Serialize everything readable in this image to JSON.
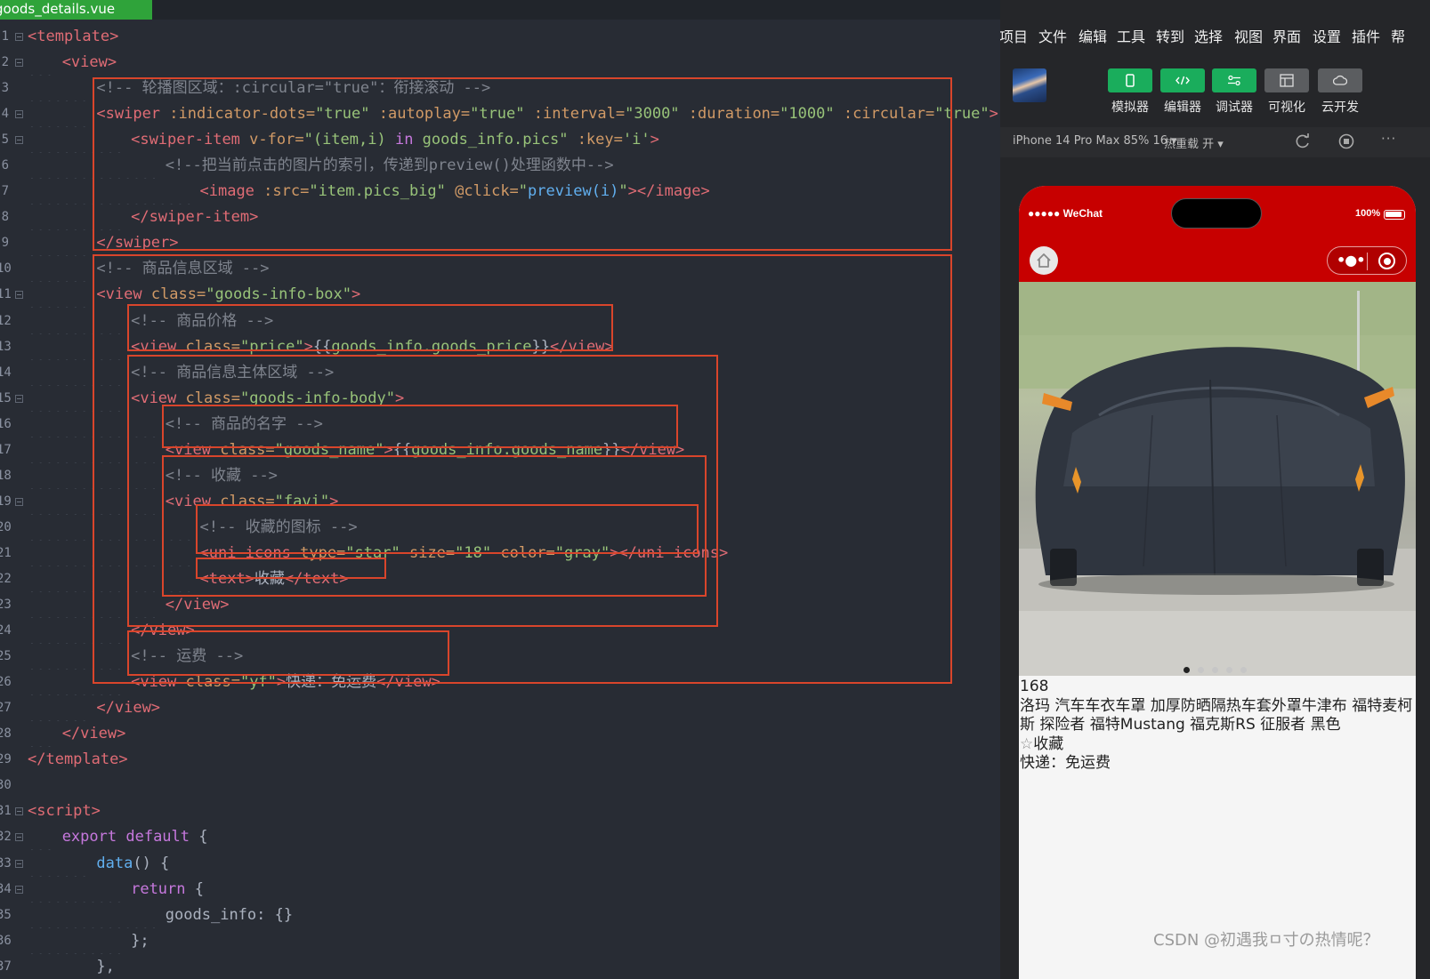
{
  "editor": {
    "tab_title": "goods_details.vue",
    "lines": [
      {
        "num": "1",
        "fold": true,
        "indent": 0,
        "tokens": [
          [
            "tag",
            "<template>"
          ]
        ]
      },
      {
        "num": "2",
        "fold": true,
        "indent": 1,
        "tokens": [
          [
            "tag",
            "<view>"
          ]
        ]
      },
      {
        "num": "3",
        "fold": false,
        "indent": 2,
        "tokens": [
          [
            "cmt",
            "<!-- 轮播图区域：:circular=\"true\"：衔接滚动 -->"
          ]
        ]
      },
      {
        "num": "4",
        "fold": true,
        "indent": 2,
        "tokens": [
          [
            "tag",
            "<swiper"
          ],
          [
            "txt",
            " "
          ],
          [
            "attr",
            ":indicator-dots="
          ],
          [
            "str",
            "\"true\""
          ],
          [
            "txt",
            " "
          ],
          [
            "attr",
            ":autoplay="
          ],
          [
            "str",
            "\"true\""
          ],
          [
            "txt",
            " "
          ],
          [
            "attr",
            ":interval="
          ],
          [
            "str",
            "\"3000\""
          ],
          [
            "txt",
            " "
          ],
          [
            "attr",
            ":duration="
          ],
          [
            "str",
            "\"1000\""
          ],
          [
            "txt",
            " "
          ],
          [
            "attr",
            ":circular="
          ],
          [
            "str",
            "\"true\""
          ],
          [
            "tag",
            ">"
          ]
        ]
      },
      {
        "num": "5",
        "fold": true,
        "indent": 3,
        "tokens": [
          [
            "tag",
            "<swiper-item"
          ],
          [
            "txt",
            " "
          ],
          [
            "attr",
            "v-for="
          ],
          [
            "str",
            "\"(item,i) "
          ],
          [
            "kw",
            "in"
          ],
          [
            "str",
            " goods_info.pics\""
          ],
          [
            "txt",
            " "
          ],
          [
            "attr",
            ":key="
          ],
          [
            "str",
            "'i'"
          ],
          [
            "tag",
            ">"
          ]
        ]
      },
      {
        "num": "6",
        "fold": false,
        "indent": 4,
        "tokens": [
          [
            "cmt",
            "<!--把当前点击的图片的索引，传递到preview()处理函数中-->"
          ]
        ]
      },
      {
        "num": "7",
        "fold": false,
        "indent": 5,
        "tokens": [
          [
            "tag",
            "<image"
          ],
          [
            "txt",
            " "
          ],
          [
            "attr",
            ":src="
          ],
          [
            "str",
            "\"item.pics_big\""
          ],
          [
            "txt",
            " "
          ],
          [
            "attr",
            "@click="
          ],
          [
            "str",
            "\""
          ],
          [
            "fn",
            "preview(i)"
          ],
          [
            "str",
            "\""
          ],
          [
            "tag",
            "></image>"
          ]
        ]
      },
      {
        "num": "8",
        "fold": false,
        "indent": 3,
        "tokens": [
          [
            "tag",
            "</swiper-item>"
          ]
        ]
      },
      {
        "num": "9",
        "fold": false,
        "indent": 2,
        "tokens": [
          [
            "tag",
            "</swiper>"
          ]
        ]
      },
      {
        "num": "10",
        "fold": false,
        "indent": 2,
        "tokens": [
          [
            "cmt",
            "<!-- 商品信息区域 -->"
          ]
        ]
      },
      {
        "num": "11",
        "fold": true,
        "indent": 2,
        "tokens": [
          [
            "tag",
            "<view"
          ],
          [
            "txt",
            " "
          ],
          [
            "attr",
            "class="
          ],
          [
            "str",
            "\"goods-info-box\""
          ],
          [
            "tag",
            ">"
          ]
        ]
      },
      {
        "num": "12",
        "fold": false,
        "indent": 3,
        "tokens": [
          [
            "cmt",
            "<!-- 商品价格 -->"
          ]
        ]
      },
      {
        "num": "13",
        "fold": false,
        "indent": 3,
        "tokens": [
          [
            "tag",
            "<view"
          ],
          [
            "txt",
            " "
          ],
          [
            "attr",
            "class="
          ],
          [
            "str",
            "\"price\""
          ],
          [
            "tag",
            ">"
          ],
          [
            "txt",
            "{{"
          ],
          [
            "str",
            "goods_info.goods_price"
          ],
          [
            "txt",
            "}}"
          ],
          [
            "tag",
            "</view>"
          ]
        ]
      },
      {
        "num": "14",
        "fold": false,
        "indent": 3,
        "tokens": [
          [
            "cmt",
            "<!-- 商品信息主体区域 -->"
          ]
        ]
      },
      {
        "num": "15",
        "fold": true,
        "indent": 3,
        "tokens": [
          [
            "tag",
            "<view"
          ],
          [
            "txt",
            " "
          ],
          [
            "attr",
            "class="
          ],
          [
            "str",
            "\"goods-info-body\""
          ],
          [
            "tag",
            ">"
          ]
        ]
      },
      {
        "num": "16",
        "fold": false,
        "indent": 4,
        "tokens": [
          [
            "cmt",
            "<!-- 商品的名字 -->"
          ]
        ]
      },
      {
        "num": "17",
        "fold": false,
        "indent": 4,
        "tokens": [
          [
            "tag",
            "<view"
          ],
          [
            "txt",
            " "
          ],
          [
            "attr",
            "class="
          ],
          [
            "str",
            "\"goods_name\""
          ],
          [
            "tag",
            ">"
          ],
          [
            "txt",
            "{{"
          ],
          [
            "str",
            "goods_info.goods_name"
          ],
          [
            "txt",
            "}}"
          ],
          [
            "tag",
            "</view>"
          ]
        ]
      },
      {
        "num": "18",
        "fold": false,
        "indent": 4,
        "tokens": [
          [
            "cmt",
            "<!-- 收藏 -->"
          ]
        ]
      },
      {
        "num": "19",
        "fold": true,
        "indent": 4,
        "tokens": [
          [
            "tag",
            "<view"
          ],
          [
            "txt",
            " "
          ],
          [
            "attr",
            "class="
          ],
          [
            "str",
            "\"favi\""
          ],
          [
            "tag",
            ">"
          ]
        ]
      },
      {
        "num": "20",
        "fold": false,
        "indent": 5,
        "tokens": [
          [
            "cmt",
            "<!-- 收藏的图标 -->"
          ]
        ]
      },
      {
        "num": "21",
        "fold": false,
        "indent": 5,
        "tokens": [
          [
            "tag",
            "<uni-icons"
          ],
          [
            "txt",
            " "
          ],
          [
            "attr",
            "type="
          ],
          [
            "str",
            "\"star\""
          ],
          [
            "txt",
            " "
          ],
          [
            "attr",
            "size="
          ],
          [
            "str",
            "\"18\""
          ],
          [
            "txt",
            " "
          ],
          [
            "attr",
            "color="
          ],
          [
            "str",
            "\"gray\""
          ],
          [
            "tag",
            "></uni-icons>"
          ]
        ]
      },
      {
        "num": "22",
        "fold": false,
        "indent": 5,
        "tokens": [
          [
            "tag",
            "<text>"
          ],
          [
            "txt",
            "收藏"
          ],
          [
            "tag",
            "</text>"
          ]
        ]
      },
      {
        "num": "23",
        "fold": false,
        "indent": 4,
        "tokens": [
          [
            "tag",
            "</view>"
          ]
        ]
      },
      {
        "num": "24",
        "fold": false,
        "indent": 3,
        "tokens": [
          [
            "tag",
            "</view>"
          ]
        ]
      },
      {
        "num": "25",
        "fold": false,
        "indent": 3,
        "tokens": [
          [
            "cmt",
            "<!-- 运费 -->"
          ]
        ]
      },
      {
        "num": "26",
        "fold": false,
        "indent": 3,
        "tokens": [
          [
            "tag",
            "<view"
          ],
          [
            "txt",
            " "
          ],
          [
            "attr",
            "class="
          ],
          [
            "str",
            "\"yf\""
          ],
          [
            "tag",
            ">"
          ],
          [
            "txt",
            "快递：免运费"
          ],
          [
            "tag",
            "</view>"
          ]
        ]
      },
      {
        "num": "27",
        "fold": false,
        "indent": 2,
        "tokens": [
          [
            "tag",
            "</view>"
          ]
        ]
      },
      {
        "num": "28",
        "fold": false,
        "indent": 1,
        "tokens": [
          [
            "tag",
            "</view>"
          ]
        ]
      },
      {
        "num": "29",
        "fold": false,
        "indent": 0,
        "tokens": [
          [
            "tag",
            "</template>"
          ]
        ]
      },
      {
        "num": "30",
        "fold": false,
        "indent": 0,
        "tokens": []
      },
      {
        "num": "31",
        "fold": true,
        "indent": 0,
        "tokens": [
          [
            "tag",
            "<script>"
          ]
        ]
      },
      {
        "num": "32",
        "fold": true,
        "indent": 1,
        "tokens": [
          [
            "kw",
            "export"
          ],
          [
            "txt",
            " "
          ],
          [
            "kw",
            "default"
          ],
          [
            "txt",
            " {"
          ]
        ]
      },
      {
        "num": "33",
        "fold": true,
        "indent": 2,
        "tokens": [
          [
            "fn",
            "data"
          ],
          [
            "txt",
            "() {"
          ]
        ]
      },
      {
        "num": "34",
        "fold": true,
        "indent": 3,
        "tokens": [
          [
            "kw",
            "return"
          ],
          [
            "txt",
            " {"
          ]
        ]
      },
      {
        "num": "35",
        "fold": false,
        "indent": 4,
        "tokens": [
          [
            "txt",
            "goods_info: {}"
          ]
        ]
      },
      {
        "num": "36",
        "fold": false,
        "indent": 3,
        "tokens": [
          [
            "txt",
            "};"
          ]
        ]
      },
      {
        "num": "37",
        "fold": false,
        "indent": 2,
        "tokens": [
          [
            "txt",
            "},"
          ]
        ]
      }
    ]
  },
  "menu": [
    "项目",
    "文件",
    "编辑",
    "工具",
    "转到",
    "选择",
    "视图",
    "界面",
    "设置",
    "插件",
    "帮"
  ],
  "toolbar": [
    {
      "label": "模拟器",
      "icon": "phone-icon",
      "style": "green"
    },
    {
      "label": "编辑器",
      "icon": "code-icon",
      "style": "green"
    },
    {
      "label": "调试器",
      "icon": "debug-icon",
      "style": "green"
    },
    {
      "label": "可视化",
      "icon": "layout-icon",
      "style": "gray"
    },
    {
      "label": "云开发",
      "icon": "cloud-icon",
      "style": "gray"
    }
  ],
  "device_bar": {
    "device": "iPhone 14 Pro Max 85% 16 ▾",
    "hot_reload": "热重载 开 ▾"
  },
  "phone": {
    "carrier": "●●●●● WeChat",
    "battery": "100%",
    "swiper_dots": 5,
    "active_dot": 0,
    "price": "168",
    "goods_name": "洛玛 汽车车衣车罩 加厚防晒隔热车套外罩牛津布 福特麦柯斯 探险者 福特Mustang 福克斯RS 征服者 黑色",
    "favi_icon": "☆",
    "favi_text": "收藏",
    "yf": "快递：免运费"
  },
  "watermark": "CSDN @初遇我ㅁ寸の热情呢？",
  "colors": {
    "accent_green": "#1aad5c",
    "wechat_red": "#c70000",
    "highlight_red": "#d9452b"
  }
}
